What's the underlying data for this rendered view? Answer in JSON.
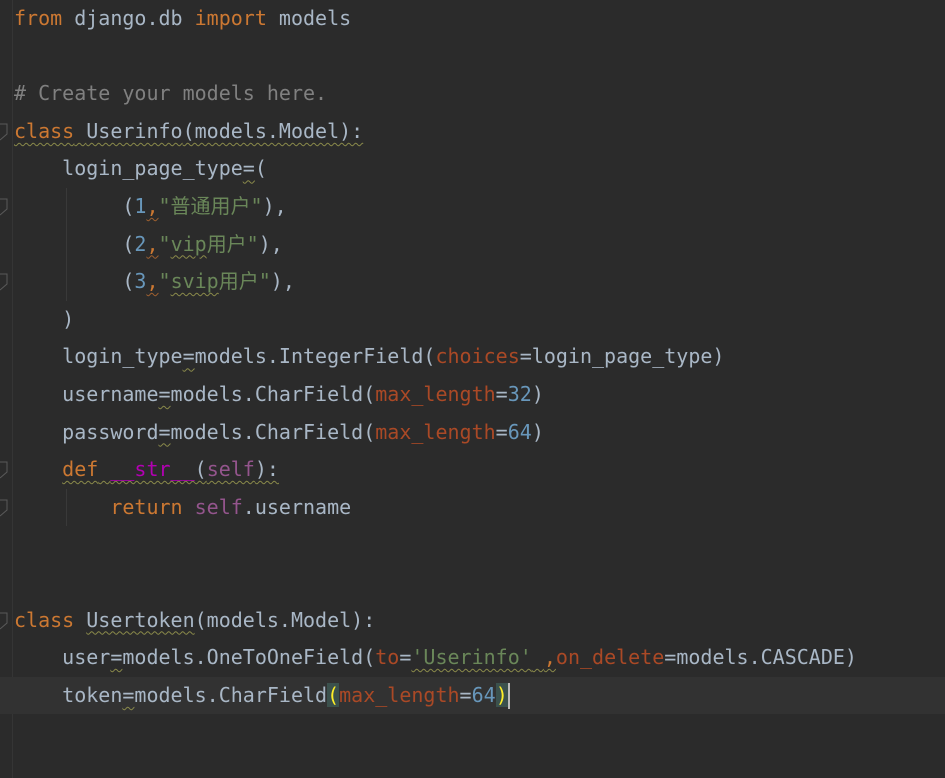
{
  "editor": {
    "lines": [
      [
        {
          "t": "from",
          "c": "kw"
        },
        {
          "t": " django.db ",
          "c": "plain"
        },
        {
          "t": "import",
          "c": "kw"
        },
        {
          "t": " models",
          "c": "plain"
        }
      ],
      [],
      [
        {
          "t": "# Create your models here.",
          "c": "cm"
        }
      ],
      [
        {
          "t": "class",
          "c": "kw squig"
        },
        {
          "t": " ",
          "c": "plain squig"
        },
        {
          "t": "Userinfo",
          "c": "plain squig"
        },
        {
          "t": "(models.Model):",
          "c": "plain squig"
        }
      ],
      [
        {
          "t": "    login_page_type",
          "c": "plain"
        },
        {
          "t": "=",
          "c": "plain squig"
        },
        {
          "t": "(",
          "c": "plain"
        }
      ],
      [
        {
          "t": "         (",
          "c": "plain"
        },
        {
          "t": "1",
          "c": "num"
        },
        {
          "t": ",",
          "c": "kw squig-r"
        },
        {
          "t": "\"普通用户\"",
          "c": "str"
        },
        {
          "t": "),",
          "c": "plain"
        }
      ],
      [
        {
          "t": "         (",
          "c": "plain"
        },
        {
          "t": "2",
          "c": "num"
        },
        {
          "t": ",",
          "c": "kw squig-r"
        },
        {
          "t": "\"",
          "c": "str"
        },
        {
          "t": "vip",
          "c": "str squig"
        },
        {
          "t": "用户\"",
          "c": "str"
        },
        {
          "t": "),",
          "c": "plain"
        }
      ],
      [
        {
          "t": "         (",
          "c": "plain"
        },
        {
          "t": "3",
          "c": "num"
        },
        {
          "t": ",",
          "c": "kw squig-r"
        },
        {
          "t": "\"",
          "c": "str"
        },
        {
          "t": "svip",
          "c": "str squig"
        },
        {
          "t": "用户\"",
          "c": "str"
        },
        {
          "t": "),",
          "c": "plain"
        }
      ],
      [
        {
          "t": "    )",
          "c": "plain"
        }
      ],
      [
        {
          "t": "    login_type",
          "c": "plain"
        },
        {
          "t": "=",
          "c": "plain squig"
        },
        {
          "t": "models.IntegerField(",
          "c": "plain"
        },
        {
          "t": "choices",
          "c": "param"
        },
        {
          "t": "=login_page_type)",
          "c": "plain"
        }
      ],
      [
        {
          "t": "    username",
          "c": "plain"
        },
        {
          "t": "=",
          "c": "plain squig"
        },
        {
          "t": "models.CharField(",
          "c": "plain"
        },
        {
          "t": "max_length",
          "c": "param"
        },
        {
          "t": "=",
          "c": "plain"
        },
        {
          "t": "32",
          "c": "num"
        },
        {
          "t": ")",
          "c": "plain"
        }
      ],
      [
        {
          "t": "    password",
          "c": "plain"
        },
        {
          "t": "=",
          "c": "plain squig"
        },
        {
          "t": "models.CharField(",
          "c": "plain"
        },
        {
          "t": "max_length",
          "c": "param"
        },
        {
          "t": "=",
          "c": "plain"
        },
        {
          "t": "64",
          "c": "num"
        },
        {
          "t": ")",
          "c": "plain"
        }
      ],
      [
        {
          "t": "    ",
          "c": "plain"
        },
        {
          "t": "def",
          "c": "kw squig"
        },
        {
          "t": " ",
          "c": "plain squig"
        },
        {
          "t": "__str__",
          "c": "magic squig"
        },
        {
          "t": "(",
          "c": "plain squig"
        },
        {
          "t": "self",
          "c": "self squig"
        },
        {
          "t": "):",
          "c": "plain squig"
        }
      ],
      [
        {
          "t": "        ",
          "c": "plain"
        },
        {
          "t": "return",
          "c": "kw"
        },
        {
          "t": " ",
          "c": "plain"
        },
        {
          "t": "self",
          "c": "self"
        },
        {
          "t": ".username",
          "c": "plain"
        }
      ],
      [],
      [],
      [
        {
          "t": "class",
          "c": "kw"
        },
        {
          "t": " ",
          "c": "plain"
        },
        {
          "t": "Usertoken",
          "c": "plain squig"
        },
        {
          "t": "(models.Model):",
          "c": "plain"
        }
      ],
      [
        {
          "t": "    user",
          "c": "plain"
        },
        {
          "t": "=",
          "c": "plain squig"
        },
        {
          "t": "models.OneToOneField(",
          "c": "plain"
        },
        {
          "t": "to",
          "c": "param"
        },
        {
          "t": "=",
          "c": "plain"
        },
        {
          "t": "'Userinfo'",
          "c": "str squig"
        },
        {
          "t": " ",
          "c": "plain squig"
        },
        {
          "t": ",",
          "c": "kw squig"
        },
        {
          "t": "on_delete",
          "c": "param"
        },
        {
          "t": "=models.CASCADE)",
          "c": "plain"
        }
      ],
      [
        {
          "t": "    token",
          "c": "plain"
        },
        {
          "t": "=",
          "c": "plain squig"
        },
        {
          "t": "models.CharField",
          "c": "plain"
        },
        {
          "t": "(",
          "c": "bracket-match"
        },
        {
          "t": "max_length",
          "c": "param"
        },
        {
          "t": "=",
          "c": "plain"
        },
        {
          "t": "64",
          "c": "num"
        },
        {
          "t": ")",
          "c": "bracket-match"
        }
      ]
    ]
  }
}
